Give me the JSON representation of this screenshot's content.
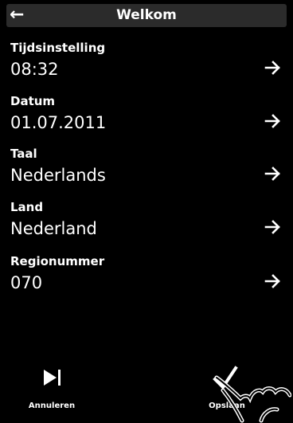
{
  "header": {
    "title": "Welkom",
    "back_icon": "arrow-left-icon"
  },
  "settings": [
    {
      "label": "Tijdsinstelling",
      "value": "08:32"
    },
    {
      "label": "Datum",
      "value": "01.07.2011"
    },
    {
      "label": "Taal",
      "value": "Nederlands"
    },
    {
      "label": "Land",
      "value": "Nederland"
    },
    {
      "label": "Regionummer",
      "value": "070"
    }
  ],
  "footer": {
    "cancel_label": "Annuleren",
    "cancel_icon": "skip-forward-icon",
    "save_label": "Opslaan",
    "save_icon": "checkmark-icon"
  },
  "colors": {
    "background": "#000000",
    "header": "#2b2b2b",
    "text": "#ffffff"
  }
}
